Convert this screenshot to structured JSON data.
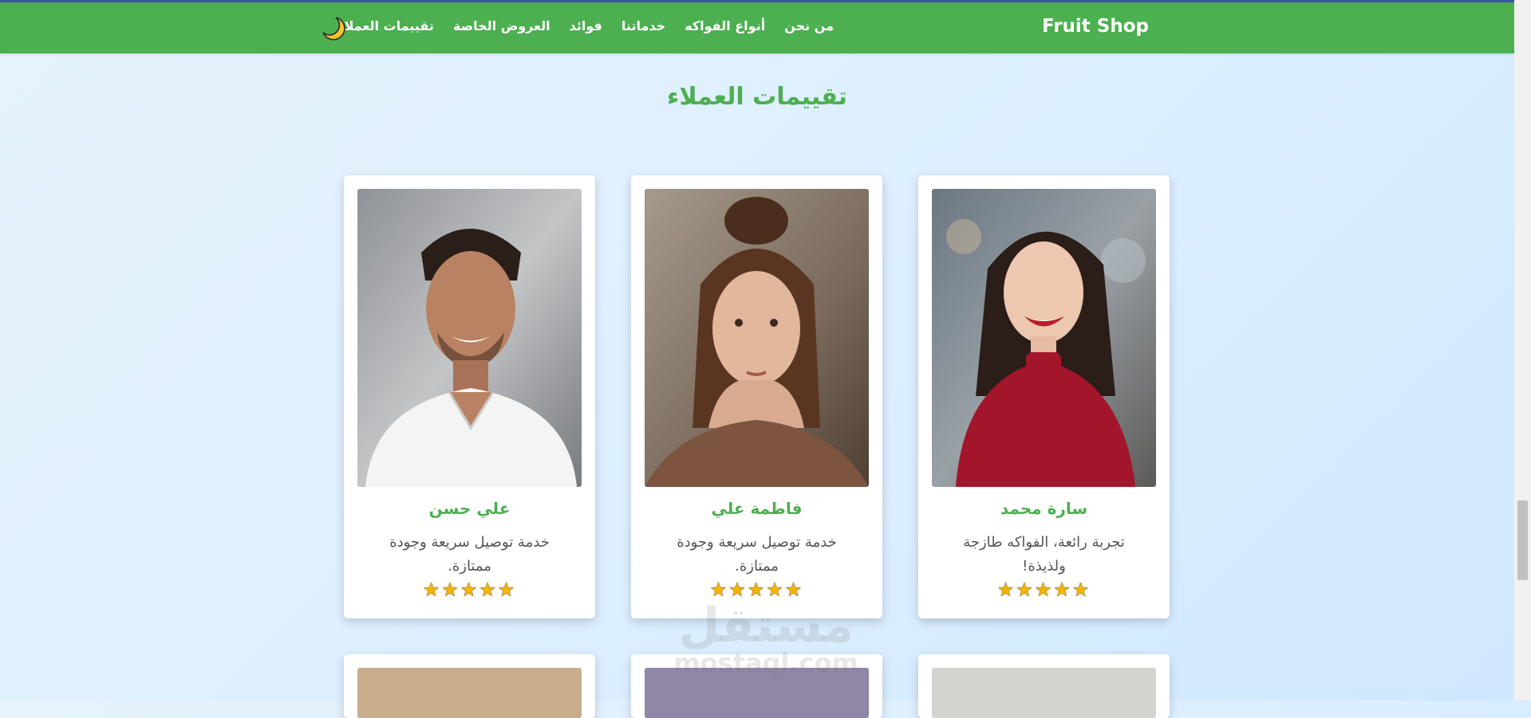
{
  "navbar": {
    "brand": "Fruit Shop",
    "links": [
      "من نحن",
      "أنواع الفواكه",
      "خدماتنا",
      "فوائد",
      "العروض الخاصة",
      "تقييمات العملاء"
    ],
    "theme_icon": "moon-icon"
  },
  "section": {
    "title": "تقييمات العملاء"
  },
  "reviews": [
    {
      "name": "سارة محمد",
      "text": "تجربة رائعة، الفواكه طازجة ولذيذة!",
      "rating": 5
    },
    {
      "name": "فاطمة علي",
      "text": "خدمة توصيل سريعة وجودة ممتازة.",
      "rating": 5
    },
    {
      "name": "علي حسن",
      "text": "خدمة توصيل سريعة وجودة ممتازة.",
      "rating": 5
    }
  ],
  "watermark": {
    "ar": "مستقل",
    "en": "mostaql.com"
  },
  "colors": {
    "primary": "#4caf50",
    "star": "#f6b400",
    "background": "#dcefff"
  }
}
